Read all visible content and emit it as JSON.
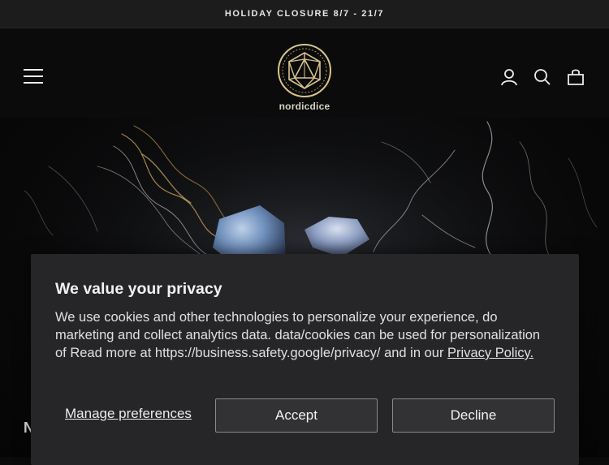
{
  "announcement": {
    "text": "HOLIDAY CLOSURE 8/7 - 21/7"
  },
  "header": {
    "logo_text": "nordicdice",
    "icons": [
      "menu-icon",
      "account-icon",
      "search-icon",
      "cart-icon"
    ]
  },
  "hero": {
    "heading_peek": "N"
  },
  "cookie_banner": {
    "title": "We value your privacy",
    "body_text": "We use cookies and other technologies to personalize your experience, do marketing and collect analytics data. data/cookies can be used for personalization of Read more at https://business.safety.google/privacy/ and in our ",
    "policy_link": "Privacy Policy.",
    "manage_label": "Manage preferences",
    "accept_label": "Accept",
    "decline_label": "Decline"
  },
  "colors": {
    "page_bg": "#0b0b0c",
    "announcement_bg": "#1c1c1d",
    "banner_bg": "#262628",
    "button_bg": "#323234",
    "logo_gold": "#d7c48a"
  }
}
